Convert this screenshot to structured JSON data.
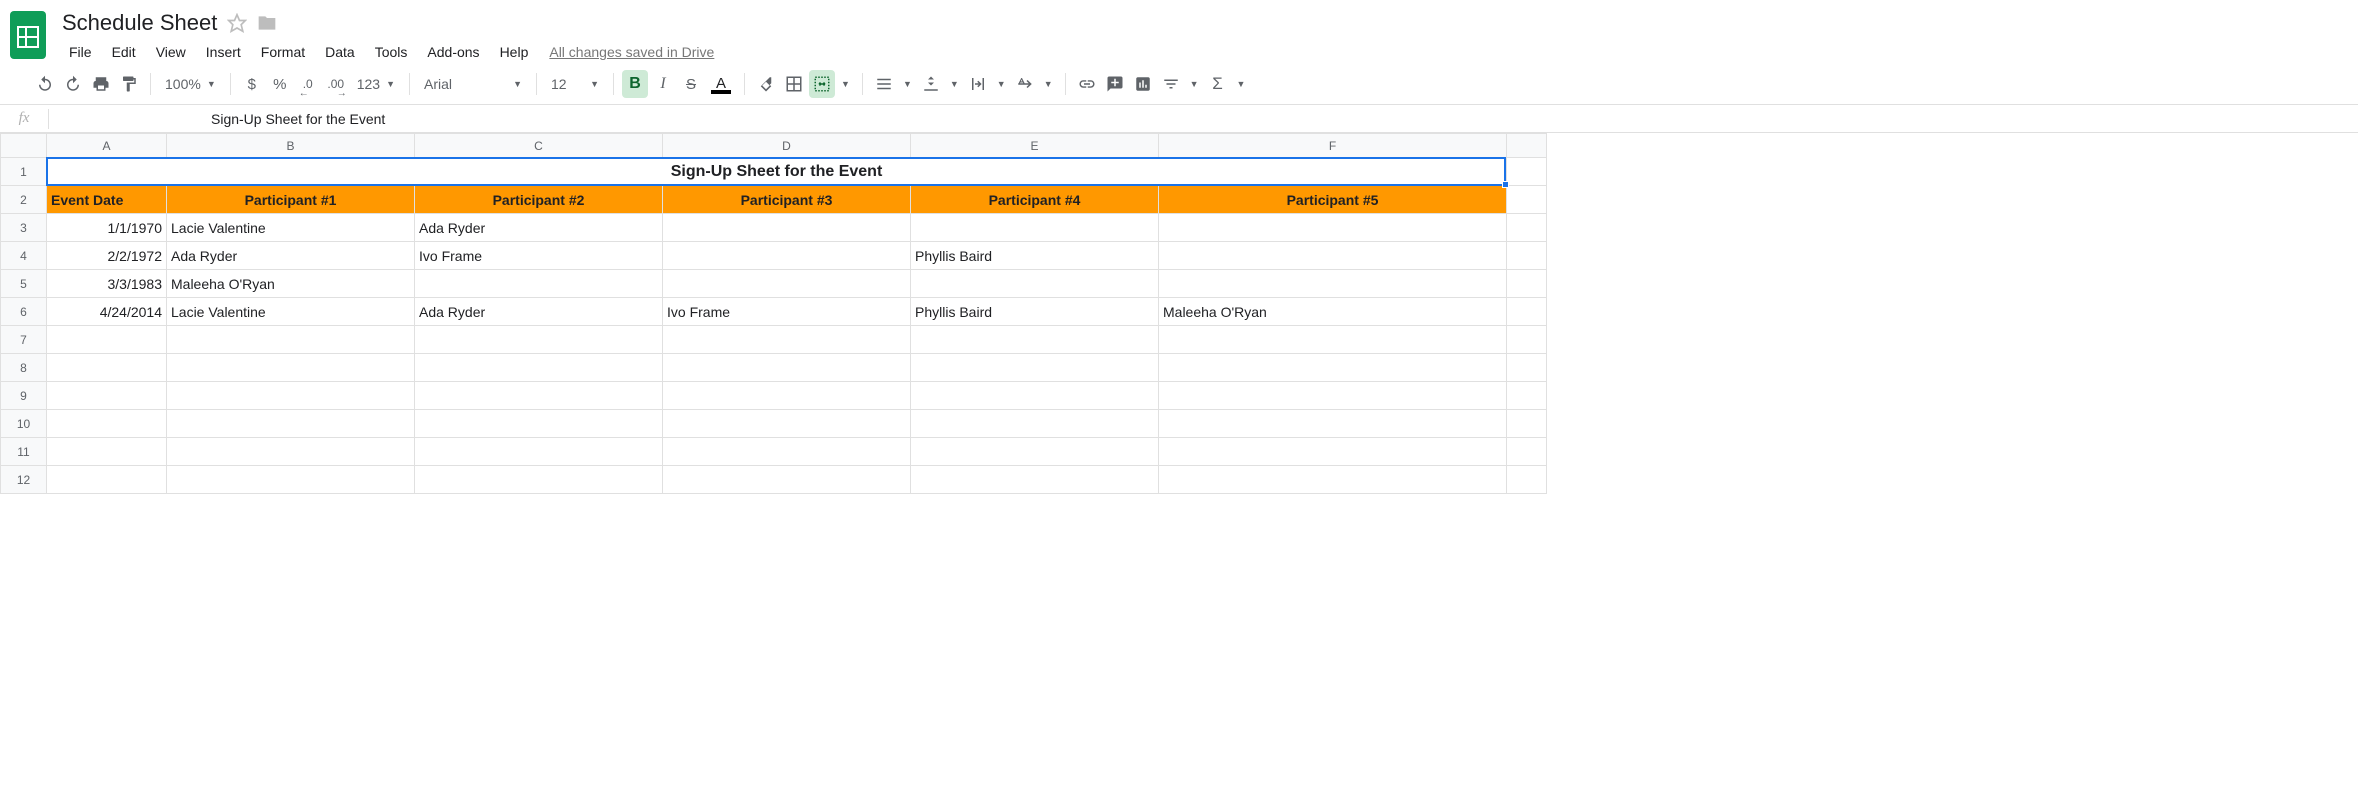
{
  "doc": {
    "title": "Schedule Sheet"
  },
  "menus": [
    "File",
    "Edit",
    "View",
    "Insert",
    "Format",
    "Data",
    "Tools",
    "Add-ons",
    "Help"
  ],
  "saved_status": "All changes saved in Drive",
  "toolbar": {
    "zoom": "100%",
    "currency": "$",
    "percent": "%",
    "dec_less": ".0",
    "dec_more": ".00",
    "more_formats": "123",
    "font": "Arial",
    "font_size": "12",
    "bold": "B",
    "italic": "I",
    "strike": "S",
    "text_color": "A"
  },
  "formula": {
    "fx": "fx",
    "value": "Sign-Up Sheet for the Event"
  },
  "columns": [
    "A",
    "B",
    "C",
    "D",
    "E",
    "F"
  ],
  "row_numbers": [
    "1",
    "2",
    "3",
    "4",
    "5",
    "6",
    "7",
    "8",
    "9",
    "10",
    "11",
    "12"
  ],
  "sheet": {
    "title_row": "Sign-Up Sheet for the Event",
    "headers": [
      "Event Date",
      "Participant #1",
      "Participant #2",
      "Participant #3",
      "Participant #4",
      "Participant #5"
    ],
    "rows": [
      {
        "date": "1/1/1970",
        "p1": "Lacie Valentine",
        "p2": "Ada Ryder",
        "p3": "",
        "p4": "",
        "p5": ""
      },
      {
        "date": "2/2/1972",
        "p1": "Ada Ryder",
        "p2": "Ivo Frame",
        "p3": "",
        "p4": "Phyllis Baird",
        "p5": ""
      },
      {
        "date": "3/3/1983",
        "p1": "Maleeha O'Ryan",
        "p2": "",
        "p3": "",
        "p4": "",
        "p5": ""
      },
      {
        "date": "4/24/2014",
        "p1": "Lacie Valentine",
        "p2": "Ada Ryder",
        "p3": "Ivo Frame",
        "p4": "Phyllis Baird",
        "p5": "Maleeha O'Ryan"
      }
    ]
  }
}
